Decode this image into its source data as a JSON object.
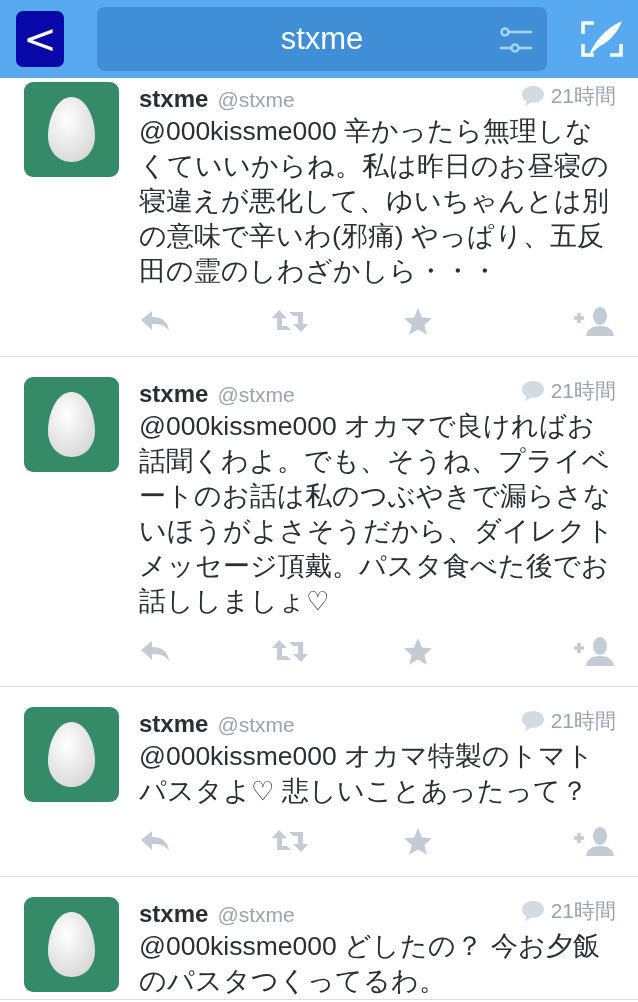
{
  "header": {
    "back": "<",
    "title": "stxme"
  },
  "tweets": [
    {
      "name": "stxme",
      "handle": "@stxme",
      "time": "21時間",
      "text": "@000kissme000 辛かったら無理しなくていいからね。私は昨日のお昼寝の寝違えが悪化して、ゆいちゃんとは別の意味で辛いわ(邪痛) やっぱり、五反田の霊のしわざかしら・・・"
    },
    {
      "name": "stxme",
      "handle": "@stxme",
      "time": "21時間",
      "text": "@000kissme000 オカマで良ければお話聞くわよ。でも、そうね、プライベートのお話は私のつぶやきで漏らさないほうがよさそうだから、ダイレクトメッセージ頂戴。パスタ食べた後でお話ししましょ♡"
    },
    {
      "name": "stxme",
      "handle": "@stxme",
      "time": "21時間",
      "text": "@000kissme000 オカマ特製のトマトパスタよ♡ 悲しいことあったって？"
    },
    {
      "name": "stxme",
      "handle": "@stxme",
      "time": "21時間",
      "text": "@000kissme000 どしたの？ 今お夕飯のパスタつくってるわ。"
    }
  ]
}
